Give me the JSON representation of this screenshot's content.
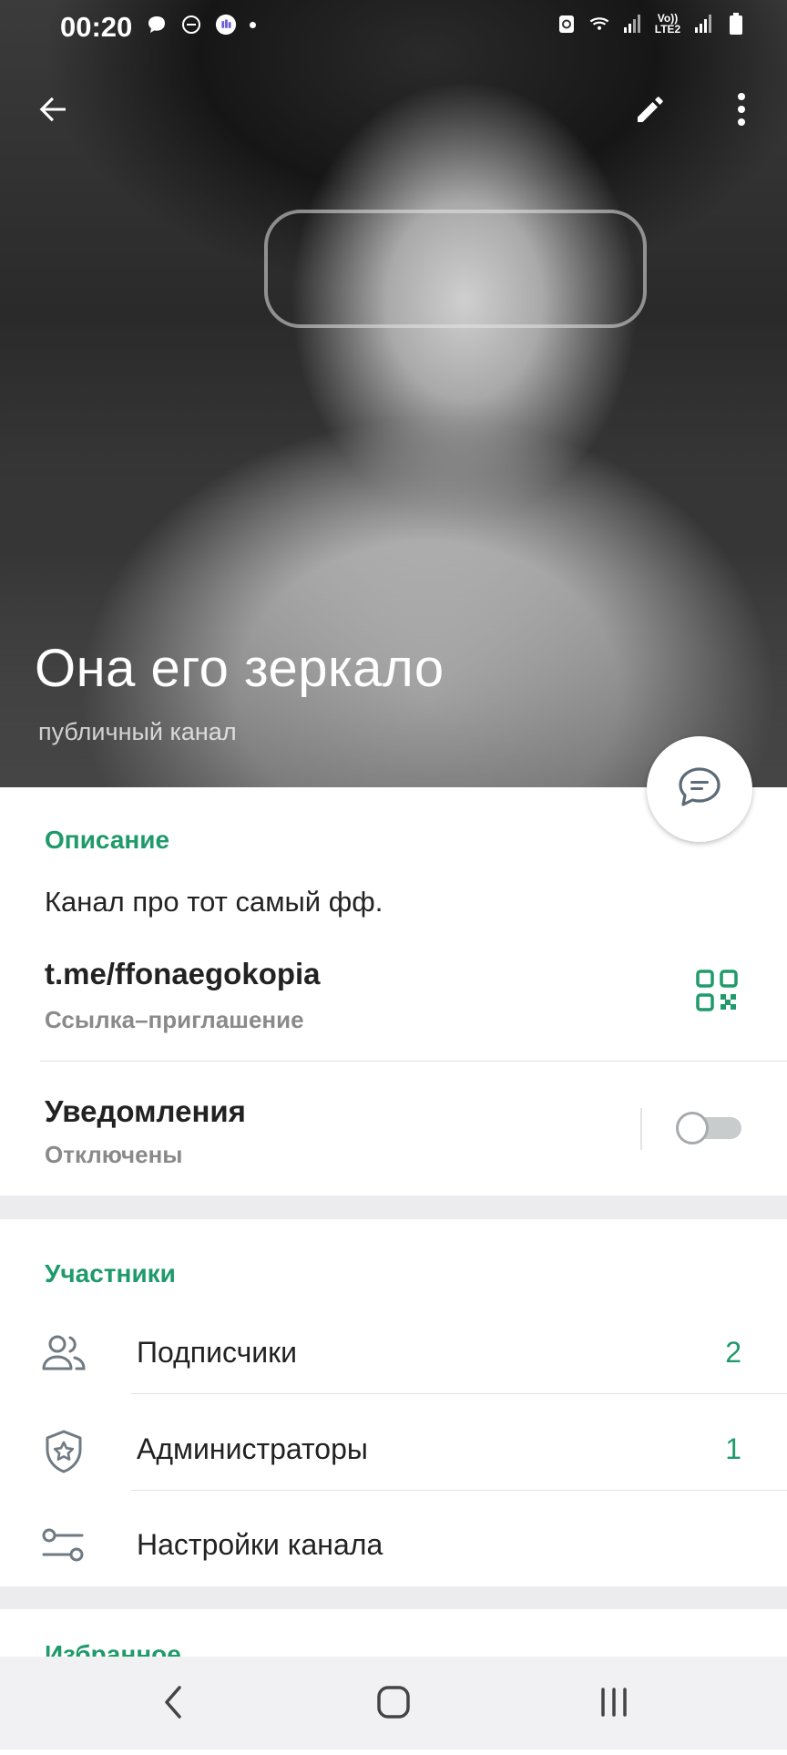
{
  "status_bar": {
    "time": "00:20",
    "lte_label_top": "Vo))",
    "lte_label_bottom": "LTE2"
  },
  "toolbar": {
    "back_icon": "arrow-left-icon",
    "edit_icon": "pencil-icon",
    "menu_icon": "more-vertical-icon"
  },
  "channel": {
    "title": "Она его зеркало",
    "subtitle": "публичный канал"
  },
  "info": {
    "description_title": "Описание",
    "description_text": "Канал про тот самый фф.",
    "link": "t.me/ffonaegokopia",
    "link_caption": "Ссылка–приглашение",
    "notifications_label": "Уведомления",
    "notifications_status": "Отключены",
    "notifications_enabled": false
  },
  "members": {
    "title": "Участники",
    "items": [
      {
        "label": "Подписчики",
        "count": "2",
        "icon": "users-icon"
      },
      {
        "label": "Администраторы",
        "count": "1",
        "icon": "shield-star-icon"
      },
      {
        "label": "Настройки канала",
        "count": "",
        "icon": "sliders-icon"
      }
    ]
  },
  "favorites": {
    "title": "Избранное"
  },
  "colors": {
    "accent": "#1f9a6a",
    "text": "#222222",
    "secondary_text": "#8a8a8a"
  }
}
